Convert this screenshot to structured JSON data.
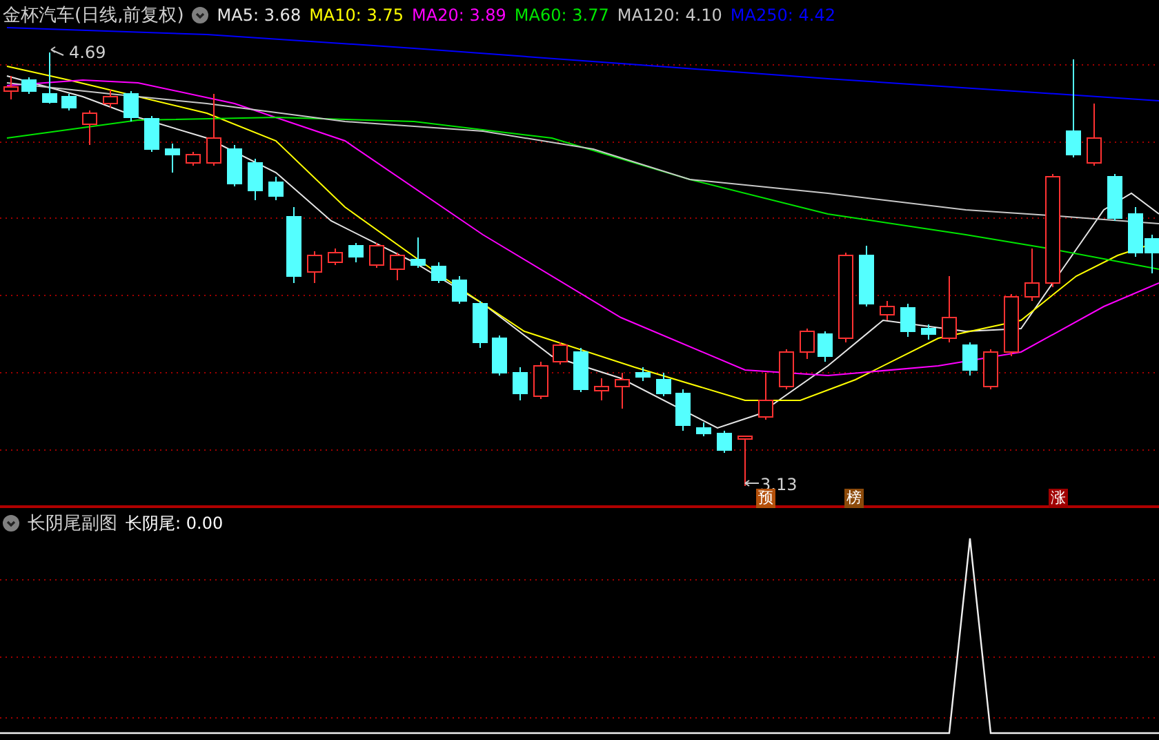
{
  "main_chart": {
    "title": "金杯汽车(日线,前复权)",
    "legend": [
      {
        "label": "MA5:",
        "value": "3.68",
        "color": "#e6e6e6"
      },
      {
        "label": "MA10:",
        "value": "3.75",
        "color": "#ffff00"
      },
      {
        "label": "MA20:",
        "value": "3.89",
        "color": "#ff00ff"
      },
      {
        "label": "MA60:",
        "value": "3.77",
        "color": "#00e600"
      },
      {
        "label": "MA120:",
        "value": "4.10",
        "color": "#c8c8c8"
      },
      {
        "label": "MA250:",
        "value": "4.42",
        "color": "#0000ff"
      }
    ],
    "high_label": "4.69",
    "low_label": "3.13",
    "markers": [
      {
        "text": "预",
        "color": "#b4500a"
      },
      {
        "text": "榜",
        "color": "#8c4a0a"
      },
      {
        "text": "涨",
        "color": "#a00000"
      }
    ]
  },
  "sub_chart": {
    "title": "长阴尾副图",
    "indicator": "长阴尾:",
    "value": "0.00"
  }
}
